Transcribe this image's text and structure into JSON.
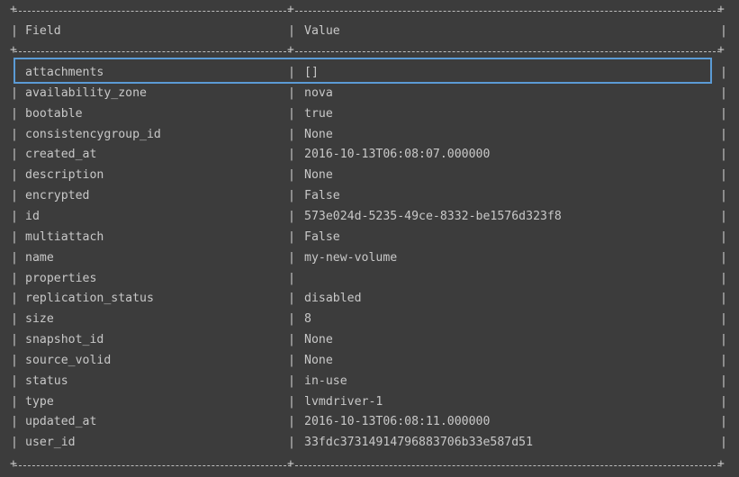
{
  "table": {
    "header": {
      "field": "Field",
      "value": "Value"
    },
    "rows": [
      {
        "field": "attachments",
        "value": "[]"
      },
      {
        "field": "availability_zone",
        "value": "nova"
      },
      {
        "field": "bootable",
        "value": "true"
      },
      {
        "field": "consistencygroup_id",
        "value": "None"
      },
      {
        "field": "created_at",
        "value": "2016-10-13T06:08:07.000000"
      },
      {
        "field": "description",
        "value": "None"
      },
      {
        "field": "encrypted",
        "value": "False"
      },
      {
        "field": "id",
        "value": "573e024d-5235-49ce-8332-be1576d323f8"
      },
      {
        "field": "multiattach",
        "value": "False"
      },
      {
        "field": "name",
        "value": "my-new-volume"
      },
      {
        "field": "properties",
        "value": ""
      },
      {
        "field": "replication_status",
        "value": "disabled"
      },
      {
        "field": "size",
        "value": "8"
      },
      {
        "field": "snapshot_id",
        "value": "None"
      },
      {
        "field": "source_volid",
        "value": "None"
      },
      {
        "field": "status",
        "value": "in-use"
      },
      {
        "field": "type",
        "value": "lvmdriver-1"
      },
      {
        "field": "updated_at",
        "value": "2016-10-13T06:08:11.000000"
      },
      {
        "field": "user_id",
        "value": "33fdc37314914796883706b33e587d51"
      }
    ]
  },
  "colors": {
    "background": "#3c3c3c",
    "text": "#c8c8c8",
    "highlight_border": "#5b9bd5"
  }
}
